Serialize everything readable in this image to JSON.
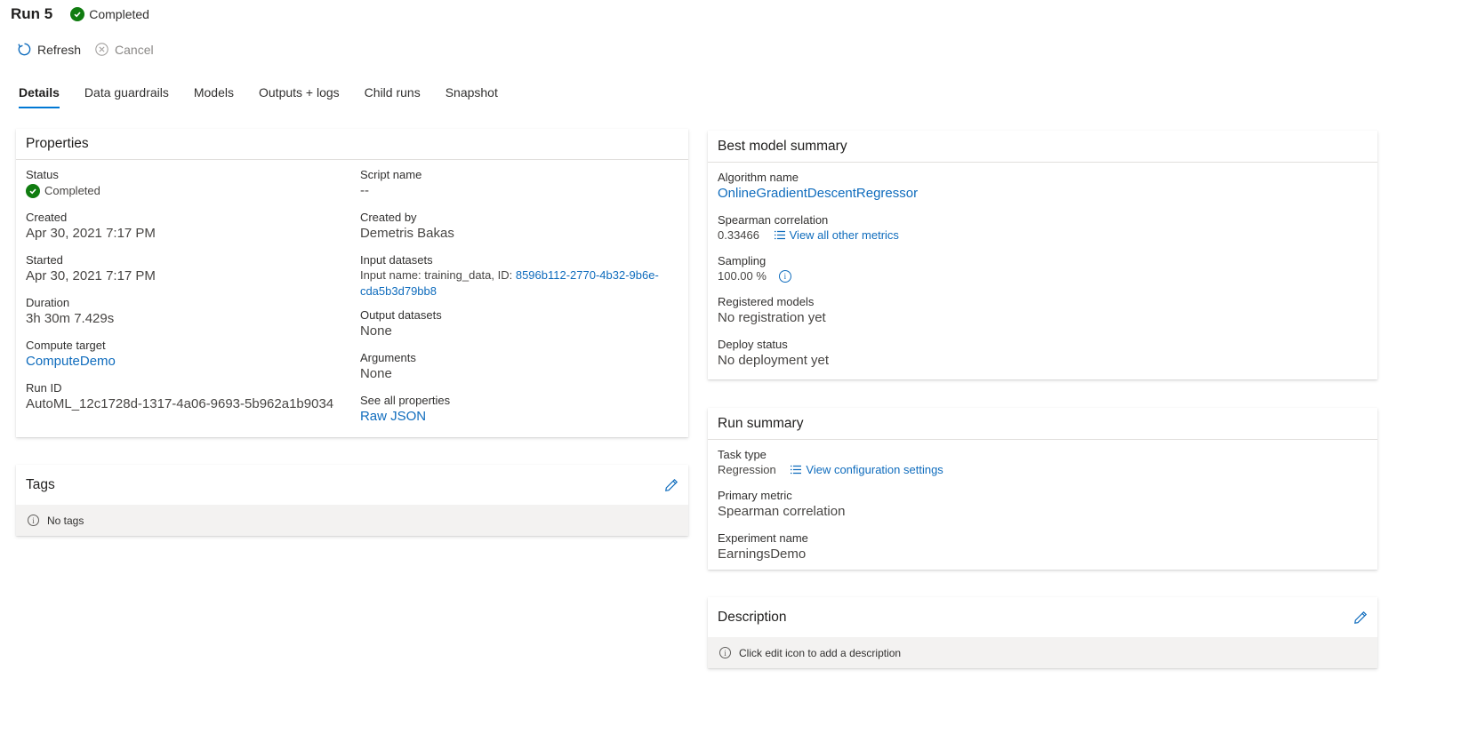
{
  "run": {
    "title": "Run 5",
    "status": "Completed"
  },
  "toolbar": {
    "refresh_label": "Refresh",
    "cancel_label": "Cancel"
  },
  "tabs": [
    {
      "label": "Details",
      "active": true
    },
    {
      "label": "Data guardrails"
    },
    {
      "label": "Models"
    },
    {
      "label": "Outputs + logs"
    },
    {
      "label": "Child runs"
    },
    {
      "label": "Snapshot"
    }
  ],
  "properties": {
    "title": "Properties",
    "status_label": "Status",
    "status_value": "Completed",
    "created_label": "Created",
    "created_value": "Apr 30, 2021 7:17 PM",
    "started_label": "Started",
    "started_value": "Apr 30, 2021 7:17 PM",
    "duration_label": "Duration",
    "duration_value": "3h 30m 7.429s",
    "compute_label": "Compute target",
    "compute_value": "ComputeDemo",
    "runid_label": "Run ID",
    "runid_value": "AutoML_12c1728d-1317-4a06-9693-5b962a1b9034",
    "script_label": "Script name",
    "script_value": "--",
    "createdby_label": "Created by",
    "createdby_value": "Demetris Bakas",
    "input_label": "Input datasets",
    "input_prefix": "Input name: training_data, ID: ",
    "input_id_line1": "8596b112-2770-4b32-9b6e-",
    "input_id_line2": "cda5b3d79bb8",
    "output_label": "Output datasets",
    "output_value": "None",
    "arguments_label": "Arguments",
    "arguments_value": "None",
    "seeall_label": "See all properties",
    "rawjson_label": "Raw JSON"
  },
  "tags": {
    "title": "Tags",
    "empty_text": "No tags"
  },
  "best_model": {
    "title": "Best model summary",
    "algorithm_label": "Algorithm name",
    "algorithm_value": "OnlineGradientDescentRegressor",
    "spearman_label": "Spearman correlation",
    "spearman_value": "0.33466",
    "metrics_link": "View all other metrics",
    "sampling_label": "Sampling",
    "sampling_value": "100.00 %",
    "registered_label": "Registered models",
    "registered_value": "No registration yet",
    "deploy_label": "Deploy status",
    "deploy_value": "No deployment yet"
  },
  "run_summary": {
    "title": "Run summary",
    "task_label": "Task type",
    "task_value": "Regression",
    "config_link": "View configuration settings",
    "primary_label": "Primary metric",
    "primary_value": "Spearman correlation",
    "experiment_label": "Experiment name",
    "experiment_value": "EarningsDemo"
  },
  "description": {
    "title": "Description",
    "empty_text": "Click edit icon to add a description"
  },
  "colors": {
    "accent": "#0f6cbd",
    "success": "#107c10",
    "tab_underline": "#0078d4"
  }
}
